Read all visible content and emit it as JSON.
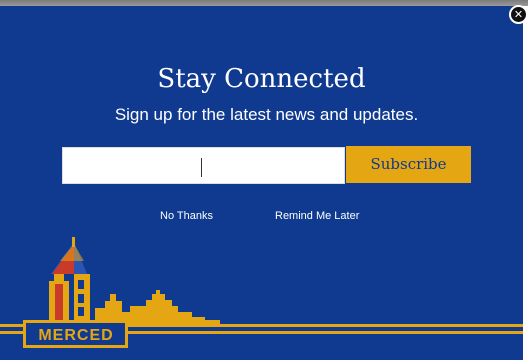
{
  "popup": {
    "title": "Stay Connected",
    "subtitle": "Sign up for the latest news and updates.",
    "email_value": "",
    "email_placeholder": "",
    "subscribe_label": "Subscribe",
    "no_thanks_label": "No Thanks",
    "remind_label": "Remind Me Later",
    "close_icon": "close-icon",
    "logo_text": "MERCED"
  },
  "colors": {
    "background": "#0f3a8f",
    "accent": "#e5a614",
    "text": "#ffffff"
  }
}
